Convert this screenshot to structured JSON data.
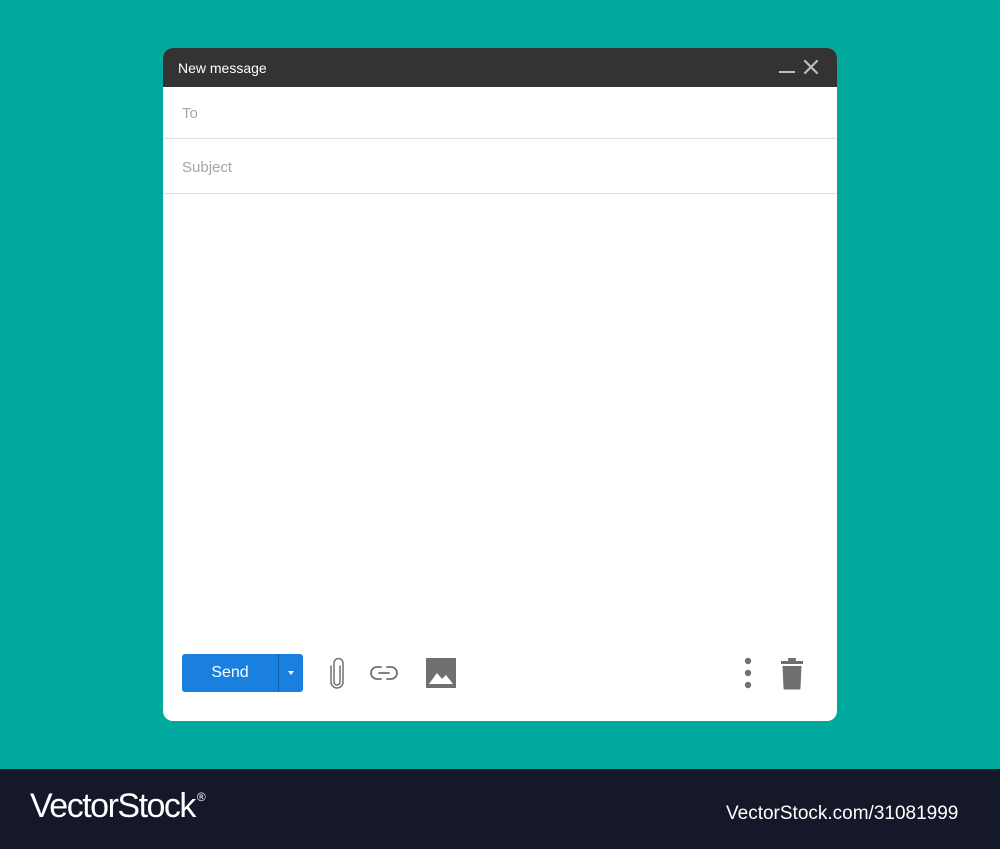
{
  "window": {
    "title": "New message",
    "minimize_icon": "minimize-icon",
    "close_icon": "close-icon"
  },
  "fields": {
    "to": {
      "placeholder": "To",
      "value": ""
    },
    "subject": {
      "placeholder": "Subject",
      "value": ""
    },
    "body": {
      "value": ""
    }
  },
  "toolbar": {
    "send_label": "Send",
    "send_options_icon": "caret-down-icon",
    "tools": [
      "paperclip-icon",
      "link-icon",
      "image-icon",
      "more-vertical-icon",
      "trash-icon"
    ]
  },
  "footer": {
    "brand_main": "VectorStock",
    "brand_reg": "®",
    "stock_id": "VectorStock.com/31081999"
  },
  "colors": {
    "background": "#00a99d",
    "titlebar": "#333333",
    "send_button": "#1a80e0",
    "icons": "#707070",
    "footer": "#141828"
  }
}
